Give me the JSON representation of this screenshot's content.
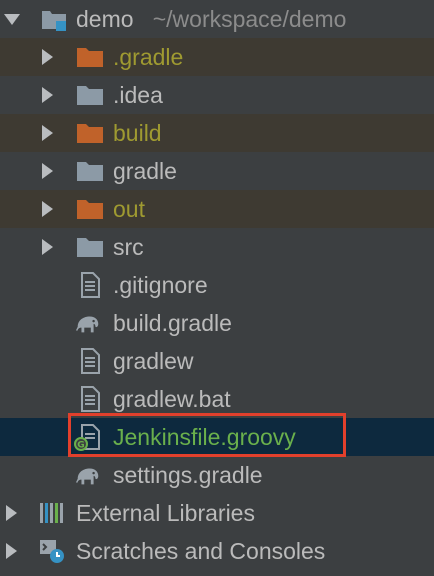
{
  "project": {
    "name": "demo",
    "path": "~/workspace/demo"
  },
  "items": [
    {
      "label": ".gradle",
      "icon": "folder-orange-icon",
      "state": "excluded"
    },
    {
      "label": ".idea",
      "icon": "folder-icon",
      "state": "normal"
    },
    {
      "label": "build",
      "icon": "folder-orange-icon",
      "state": "excluded"
    },
    {
      "label": "gradle",
      "icon": "folder-icon",
      "state": "normal"
    },
    {
      "label": "out",
      "icon": "folder-orange-icon",
      "state": "excluded"
    },
    {
      "label": "src",
      "icon": "folder-icon",
      "state": "normal"
    },
    {
      "label": ".gitignore",
      "icon": "text-file-icon",
      "state": "normal"
    },
    {
      "label": "build.gradle",
      "icon": "gradle-elephant-icon",
      "state": "normal"
    },
    {
      "label": "gradlew",
      "icon": "text-file-icon",
      "state": "normal"
    },
    {
      "label": "gradlew.bat",
      "icon": "text-file-icon",
      "state": "normal"
    },
    {
      "label": "Jenkinsfile.groovy",
      "icon": "groovy-file-icon",
      "state": "selected"
    },
    {
      "label": "settings.gradle",
      "icon": "gradle-elephant-icon",
      "state": "normal"
    }
  ],
  "root_items": [
    {
      "label": "External Libraries",
      "icon": "libraries-icon"
    },
    {
      "label": "Scratches and Consoles",
      "icon": "scratches-icon"
    }
  ],
  "colors": {
    "background": "#3c3f41",
    "excluded_background": "#3e3a32",
    "selected_background": "#0d293e",
    "excluded_text": "#9f9a31",
    "selected_text": "#6ab04c",
    "highlight_border": "#e2402c"
  }
}
